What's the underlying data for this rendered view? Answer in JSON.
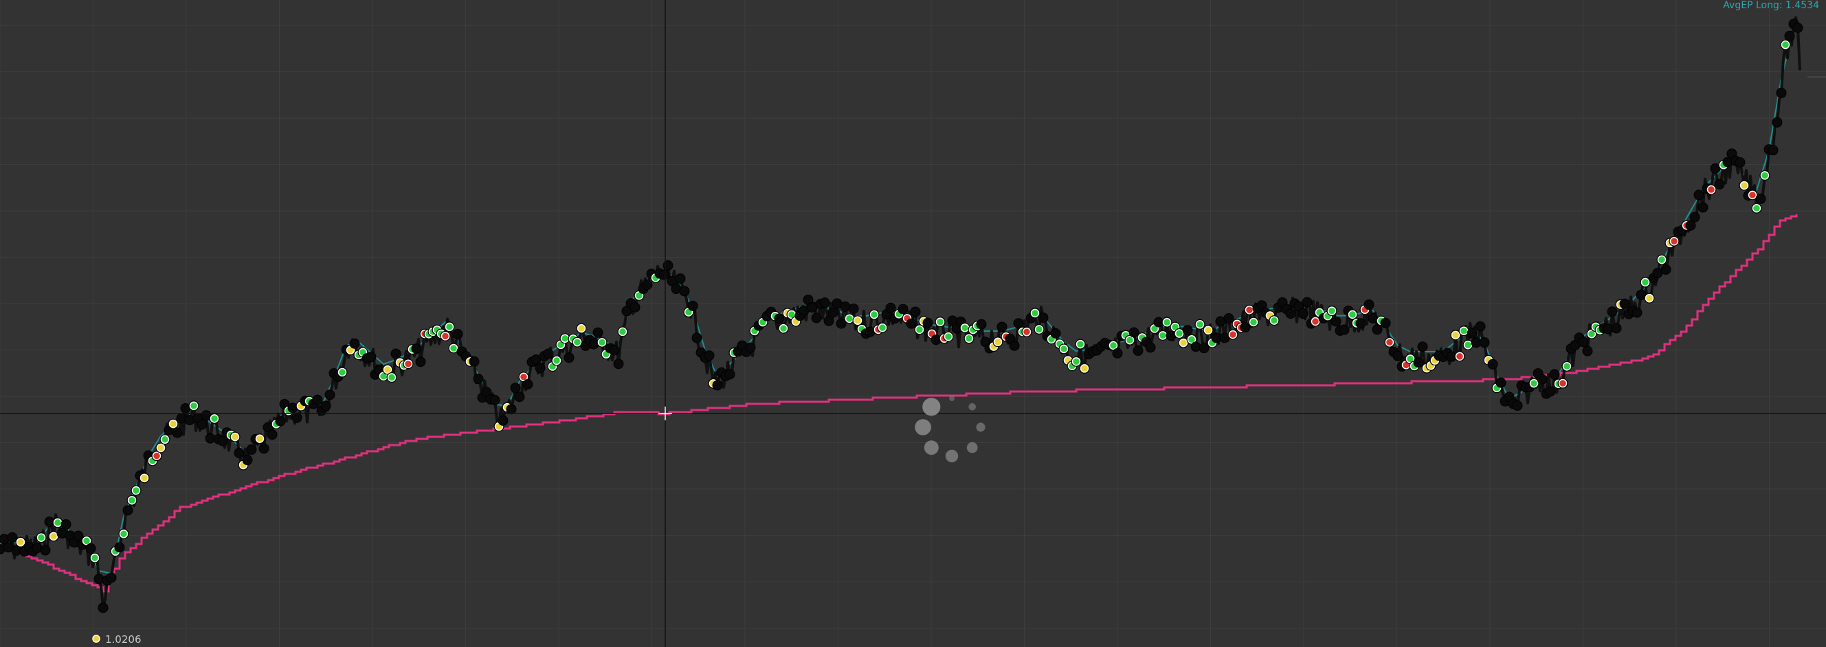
{
  "labels": {
    "avg_ep": "AvgEP Long: 1.4534",
    "low_price": "1.0206"
  },
  "colors": {
    "background": "#333333",
    "grid": "#3d3d3d",
    "crosshair": "#111111",
    "price_line": "#101010",
    "trailing_line": "#1f8f8f",
    "avg_line": "#e0307f",
    "buy_marker": "#2ecc40",
    "sell_marker": "#d9342b",
    "neutral_marker": "#e8d23a",
    "spinner": "#8a8a8a"
  },
  "icons": {
    "spinner": "loading-spinner-icon",
    "crosshair": "crosshair-cursor-icon"
  }
}
